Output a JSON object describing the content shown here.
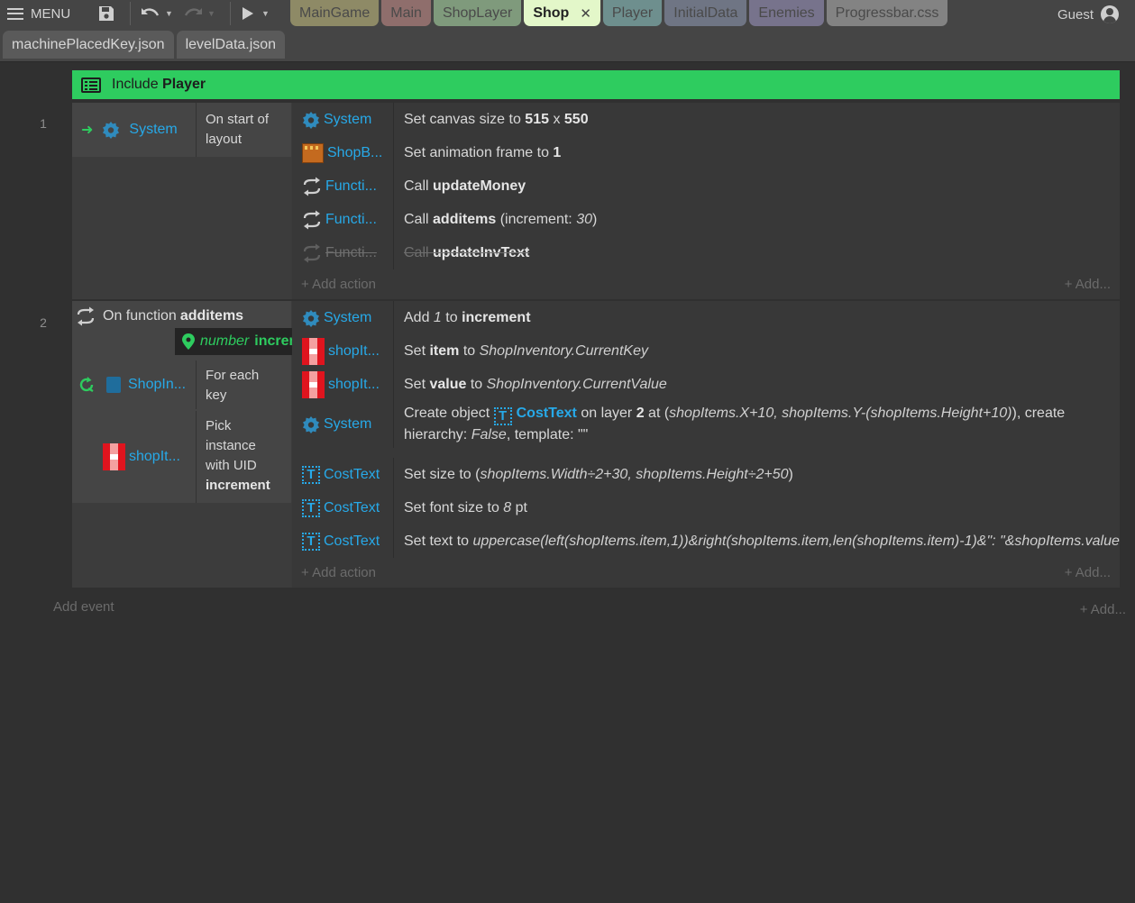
{
  "toolbar": {
    "menu_label": "MENU"
  },
  "tabs_top": [
    {
      "label": "MainGame",
      "color": "#8e8a66"
    },
    {
      "label": "Main",
      "color": "#8f6e6c"
    },
    {
      "label": "ShopLayer",
      "color": "#7f9a7c"
    },
    {
      "label": "Shop",
      "color": "#e3f7c9",
      "active": true,
      "close": "✕"
    },
    {
      "label": "Player",
      "color": "#6e8f8e"
    },
    {
      "label": "InitialData",
      "color": "#6f7584"
    },
    {
      "label": "Enemies",
      "color": "#77738c"
    },
    {
      "label": "Progressbar.css",
      "color": "#838383"
    }
  ],
  "tabs_second": [
    {
      "label": "machinePlacedKey.json"
    },
    {
      "label": "levelData.json"
    }
  ],
  "user": {
    "label": "Guest"
  },
  "include": {
    "prefix": "Include",
    "name": "Player"
  },
  "events": [
    {
      "number": "1",
      "condition": {
        "object": "System",
        "text": "On start of layout"
      },
      "actions": [
        {
          "object": "System",
          "parts": [
            [
              "Set canvas size to ",
              ""
            ],
            [
              "515",
              "b"
            ],
            [
              " x ",
              ""
            ],
            [
              "550",
              "b"
            ]
          ]
        },
        {
          "object": "ShopB...",
          "parts": [
            [
              "Set animation frame to ",
              ""
            ],
            [
              "1",
              "b"
            ]
          ]
        },
        {
          "object": "Functi...",
          "parts": [
            [
              "Call ",
              ""
            ],
            [
              "updateMoney",
              "b"
            ]
          ]
        },
        {
          "object": "Functi...",
          "parts": [
            [
              "Call ",
              ""
            ],
            [
              "additems",
              "b"
            ],
            [
              " (increment: ",
              ""
            ],
            [
              "30",
              "em"
            ],
            [
              ")",
              ""
            ]
          ]
        },
        {
          "object": "Functi...",
          "disabled": true,
          "parts": [
            [
              "Call ",
              ""
            ],
            [
              "updateInvText",
              "b"
            ]
          ]
        }
      ],
      "add_action": "Add action",
      "add_right": "Add..."
    },
    {
      "number": "2",
      "function": {
        "prefix": "On function",
        "name": "additems",
        "param_type": "number",
        "param_name": "increment"
      },
      "conditions": [
        {
          "object": "ShopIn...",
          "text": "For each key"
        },
        {
          "object": "shopIt...",
          "text_plain": "Pick instance with UID",
          "text_bold": "increment"
        }
      ],
      "actions": [
        {
          "object": "System",
          "parts": [
            [
              "Add ",
              ""
            ],
            [
              "1",
              "em"
            ],
            [
              " to ",
              ""
            ],
            [
              "increment",
              "b"
            ]
          ]
        },
        {
          "object": "shopIt...",
          "parts": [
            [
              "Set ",
              ""
            ],
            [
              "item",
              "b"
            ],
            [
              " to ",
              ""
            ],
            [
              "ShopInventory.CurrentKey",
              "em"
            ]
          ]
        },
        {
          "object": "shopIt...",
          "parts": [
            [
              "Set ",
              ""
            ],
            [
              "value",
              "b"
            ],
            [
              " to ",
              ""
            ],
            [
              "ShopInventory.CurrentValue",
              "em"
            ]
          ]
        },
        {
          "object": "System",
          "create": {
            "pre": "Create object ",
            "obj": "CostText",
            "mid1": " on layer ",
            "layer": "2",
            "mid2": " at (",
            "coords": "shopItems.X+10, shopItems.Y-(shopItems.Height+10)",
            "mid3": "), create hierarchy: ",
            "hier": "False",
            "mid4": ", template: \"\""
          }
        },
        {
          "object": "CostText",
          "parts": [
            [
              "Set size to (",
              ""
            ],
            [
              "shopItems.Width÷2+30, shopItems.Height÷2+50",
              "em"
            ],
            [
              ")",
              ""
            ]
          ]
        },
        {
          "object": "CostText",
          "parts": [
            [
              "Set font size to ",
              ""
            ],
            [
              "8",
              "em"
            ],
            [
              " pt",
              ""
            ]
          ]
        },
        {
          "object": "CostText",
          "parts": [
            [
              "Set text to ",
              ""
            ],
            [
              "uppercase(left(shopItems.item,1))&right(shopItems.item,len(shopItems.item)-1)&\": \"&shopItems.value",
              "em"
            ]
          ]
        }
      ],
      "add_action": "Add action",
      "add_right": "Add..."
    }
  ],
  "footer": {
    "add_event": "Add event",
    "add_right": "Add..."
  },
  "icons": {
    "menu": "hamburger-icon",
    "save": "floppy-icon",
    "undo": "undo-icon",
    "redo": "redo-icon",
    "play": "play-icon",
    "user": "user-icon",
    "include": "list-icon",
    "gear": "gear-icon",
    "function": "function-arrows-icon",
    "loop": "loop-icon",
    "pin": "pin-icon"
  },
  "colors": {
    "accent": "#2ecc5f",
    "object_link": "#27a9e8"
  }
}
